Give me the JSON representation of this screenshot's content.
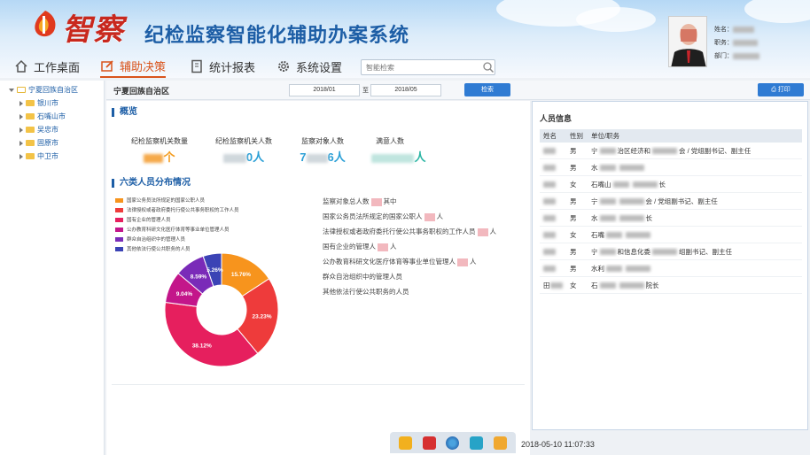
{
  "header": {
    "logo_text": "智察",
    "system_title": "纪检监察智能化辅助办案系统",
    "user": {
      "name_label": "姓名：",
      "role_label": "职务：",
      "dept_label": "部门："
    }
  },
  "nav": {
    "items": [
      {
        "label": "工作桌面",
        "icon": "home-icon"
      },
      {
        "label": "辅助决策",
        "icon": "edit-icon"
      },
      {
        "label": "统计报表",
        "icon": "document-icon"
      },
      {
        "label": "系统设置",
        "icon": "gear-icon"
      }
    ],
    "active": "辅助决策",
    "search_placeholder": "智能检索"
  },
  "sidebar": {
    "root": "宁夏回族自治区",
    "items": [
      "银川市",
      "石嘴山市",
      "吴忠市",
      "固原市",
      "中卫市"
    ]
  },
  "toolbar": {
    "title": "宁夏回族自治区",
    "date_from": "2018/01",
    "date_sep": "至",
    "date_to": "2018/05",
    "search_button": "检索",
    "print_button": "打印"
  },
  "overview": {
    "title": "概览",
    "stats": [
      {
        "label": "纪检监察机关数量",
        "value_suffix": "个",
        "color": "#f39a1b"
      },
      {
        "label": "纪检监察机关人数",
        "value_suffix": "0人",
        "color": "#2a9fd6"
      },
      {
        "label": "监察对象人数",
        "value_prefix": "7",
        "value_suffix": "6人",
        "color": "#2a9fd6"
      },
      {
        "label": "满意人数",
        "value_suffix": "人",
        "color": "#2bb5a4"
      }
    ]
  },
  "distribution": {
    "title": "六类人员分布情况",
    "legend": [
      {
        "label": "国家公务员法所规定的国家公职人员",
        "color": "#f7941d"
      },
      {
        "label": "法律授权或者政府委托行使公共事务职权的工作人员",
        "color": "#ee3b3b"
      },
      {
        "label": "国有企业的管理人员",
        "color": "#e61f5e"
      },
      {
        "label": "公办教育科研文化医疗体育等事业单位管理人员",
        "color": "#c3168a"
      },
      {
        "label": "群众自治组织中的管理人员",
        "color": "#7a2bb8"
      },
      {
        "label": "其他依法行使公共职务的人员",
        "color": "#3b43b5"
      }
    ],
    "descriptions": [
      {
        "prefix": "监察对象总人数",
        "suffix": "其中"
      },
      {
        "prefix": "国家公务员法所规定的国家公职人",
        "suffix": "人"
      },
      {
        "prefix": "法律授权或者政府委托行使公共事务职权的工作人员",
        "suffix": "人"
      },
      {
        "prefix": "国有企业的管理人",
        "suffix": "人"
      },
      {
        "prefix": "公办教育科研文化医疗体育等事业单位管理人",
        "suffix": "人"
      },
      {
        "prefix": "群众自治组织中的管理人员",
        "suffix": ""
      },
      {
        "prefix": "其他依法行使公共职务的人员",
        "suffix": ""
      }
    ]
  },
  "chart_data": {
    "type": "pie",
    "donut": true,
    "categories": [
      "国家公务员法所规定的国家公职人员",
      "法律授权或者政府委托行使公共事务职权的工作人员",
      "国有企业的管理人员",
      "公办教育科研文化医疗体育等事业单位管理人员",
      "群众自治组织中的管理人员",
      "其他依法行使公共职务的人员"
    ],
    "values": [
      15.76,
      23.23,
      38.12,
      9.04,
      8.59,
      5.26
    ],
    "labels": [
      "15.76%",
      "23.23%",
      "38.12%",
      "9.04%",
      "8.59%",
      "5.26%"
    ],
    "colors": [
      "#f7941d",
      "#ee3b3b",
      "#e61f5e",
      "#c3168a",
      "#7a2bb8",
      "#3b43b5"
    ]
  },
  "personnel": {
    "title": "人员信息",
    "headers": [
      "姓名",
      "性别",
      "单位/职务"
    ],
    "rows": [
      {
        "name": "",
        "gender": "男",
        "unit": "宁",
        "unit_tail": "治区经济和",
        "duty": "会 / 党组副书记、副主任"
      },
      {
        "name": "",
        "gender": "男",
        "unit": "水",
        "unit_tail": "",
        "duty": ""
      },
      {
        "name": "",
        "gender": "女",
        "unit": "石嘴山",
        "unit_tail": "",
        "duty": "长"
      },
      {
        "name": "",
        "gender": "男",
        "unit": "宁",
        "unit_tail": "",
        "duty": "会 / 党组副书记、副主任"
      },
      {
        "name": "",
        "gender": "男",
        "unit": "水",
        "unit_tail": "",
        "duty": "长"
      },
      {
        "name": "",
        "gender": "女",
        "unit": "石嘴",
        "unit_tail": "",
        "duty": ""
      },
      {
        "name": "",
        "gender": "男",
        "unit": "宁",
        "unit_tail": "和信息化委",
        "duty": "组副书记、副主任"
      },
      {
        "name": "",
        "gender": "男",
        "unit": "水利",
        "unit_tail": "",
        "duty": ""
      },
      {
        "name": "田",
        "gender": "女",
        "unit": "石",
        "unit_tail": "",
        "duty": "院长"
      }
    ]
  },
  "status": {
    "clock": "2018-05-10 11:07:33"
  }
}
